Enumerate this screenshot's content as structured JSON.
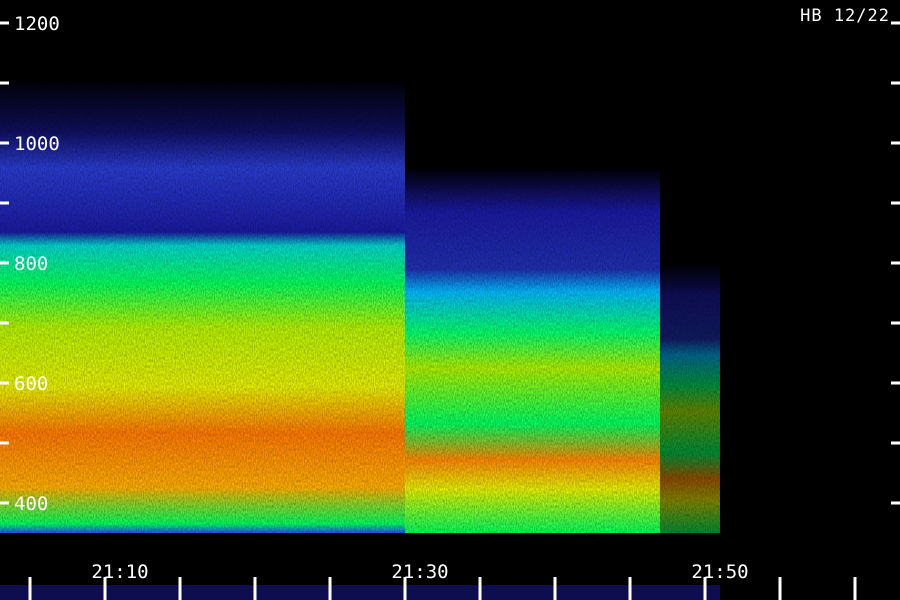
{
  "stamp": "HB 12/22",
  "chart_data": {
    "type": "heatmap",
    "title": "",
    "xlabel": "",
    "ylabel": "",
    "x_tick_labels": [
      "21:10",
      "21:30",
      "21:50"
    ],
    "y_tick_labels": [
      "1200",
      "1000",
      "800",
      "600",
      "400"
    ],
    "y_tick_values": [
      1200,
      1000,
      800,
      600,
      400
    ],
    "ylim": [
      350,
      1250
    ],
    "xlim": [
      "21:02",
      "22:02"
    ],
    "colormap": [
      "#000000",
      "#1a1aa0",
      "#2a4cff",
      "#00c8ff",
      "#00ff60",
      "#e8f000",
      "#ff7a00"
    ],
    "regions": [
      {
        "time_start": "21:02",
        "time_end": "21:29",
        "freq_low": 350,
        "freq_high": 1110,
        "description_level": "strong"
      },
      {
        "time_start": "21:29",
        "time_end": "21:46",
        "freq_low": 350,
        "freq_high": 960,
        "description_level": "strong"
      },
      {
        "time_start": "21:46",
        "time_end": "21:50",
        "freq_low": 350,
        "freq_high": 800,
        "description_level": "fading"
      }
    ]
  }
}
